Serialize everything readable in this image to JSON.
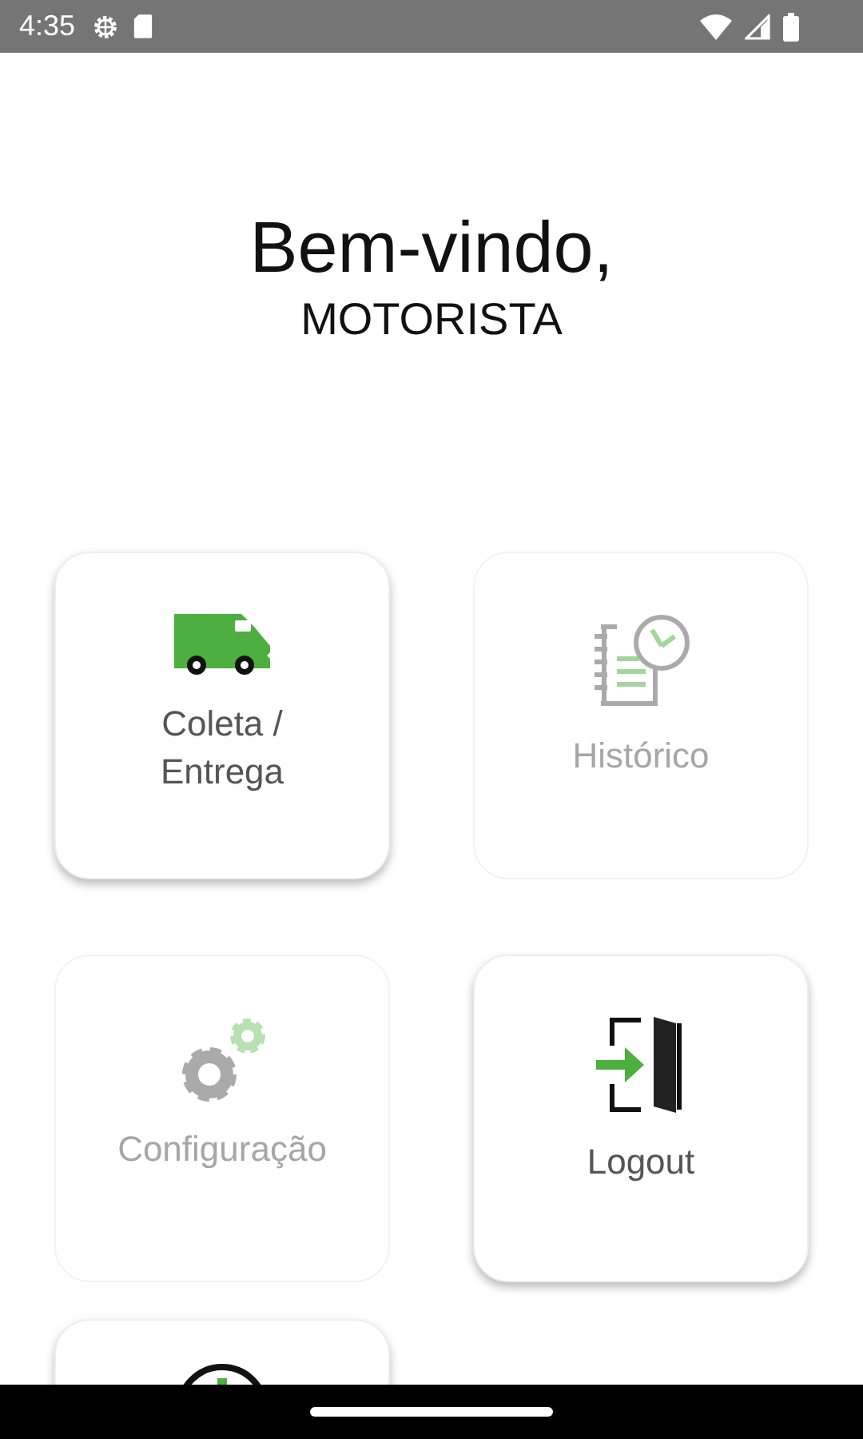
{
  "status_bar": {
    "time": "4:35"
  },
  "greeting": {
    "title": "Bem-vindo,",
    "user": "MOTORISTA"
  },
  "menu": [
    {
      "kind": "delivery",
      "label": "Coleta /\nEntrega",
      "disabled": false
    },
    {
      "kind": "history",
      "label": "Histórico",
      "disabled": true
    },
    {
      "kind": "settings",
      "label": "Configuração",
      "disabled": true
    },
    {
      "kind": "logout",
      "label": "Logout",
      "disabled": false
    },
    {
      "kind": "partial",
      "disabled": false
    }
  ]
}
